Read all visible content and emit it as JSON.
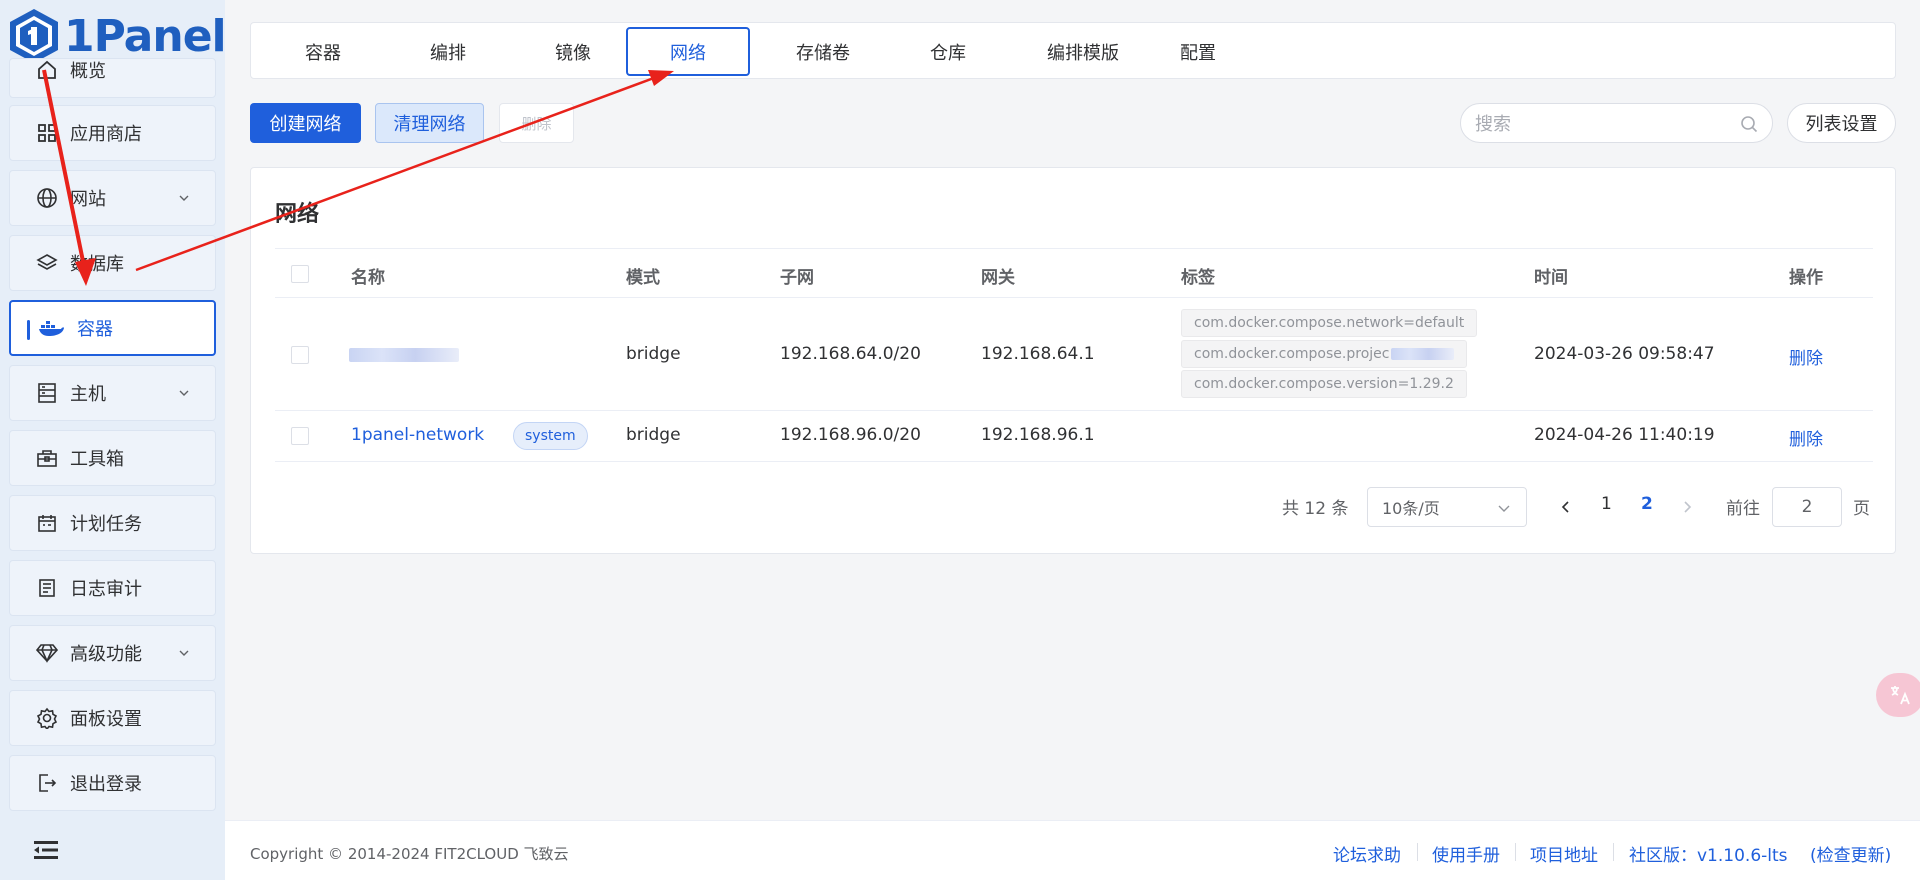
{
  "app": {
    "logo_text": "1Panel"
  },
  "sidebar": {
    "items": [
      {
        "label": "概览",
        "icon": "home-icon"
      },
      {
        "label": "应用商店",
        "icon": "apps-icon"
      },
      {
        "label": "网站",
        "icon": "globe-icon",
        "expandable": true
      },
      {
        "label": "数据库",
        "icon": "layers-icon"
      },
      {
        "label": "容器",
        "icon": "docker-icon",
        "active": true
      },
      {
        "label": "主机",
        "icon": "server-icon",
        "expandable": true
      },
      {
        "label": "工具箱",
        "icon": "toolbox-icon"
      },
      {
        "label": "计划任务",
        "icon": "calendar-icon"
      },
      {
        "label": "日志审计",
        "icon": "log-icon"
      },
      {
        "label": "高级功能",
        "icon": "diamond-icon",
        "expandable": true
      },
      {
        "label": "面板设置",
        "icon": "gear-icon"
      },
      {
        "label": "退出登录",
        "icon": "logout-icon"
      }
    ]
  },
  "tabs": [
    "容器",
    "编排",
    "镜像",
    "网络",
    "存储卷",
    "仓库",
    "编排模版",
    "配置"
  ],
  "active_tab": "网络",
  "toolbar": {
    "create_label": "创建网络",
    "prune_label": "清理网络",
    "delete_label": "删除",
    "search_placeholder": "搜索",
    "columns_label": "列表设置"
  },
  "card": {
    "title": "网络",
    "columns": [
      "名称",
      "模式",
      "子网",
      "网关",
      "标签",
      "时间",
      "操作"
    ],
    "rows": [
      {
        "name": "",
        "mode": "bridge",
        "subnet": "192.168.64.0/20",
        "gateway": "192.168.64.1",
        "tags": [
          "com.docker.compose.network=default",
          "com.docker.compose.projec",
          "com.docker.compose.version=1.29.2"
        ],
        "time": "2024-03-26 09:58:47",
        "action": "删除"
      },
      {
        "name": "1panel-network",
        "badge": "system",
        "mode": "bridge",
        "subnet": "192.168.96.0/20",
        "gateway": "192.168.96.1",
        "tags": [],
        "time": "2024-04-26 11:40:19",
        "action": "删除"
      }
    ]
  },
  "pagination": {
    "total_text": "共 12 条",
    "page_size": "10条/页",
    "pages": [
      "1",
      "2"
    ],
    "current_page": "2",
    "goto_label": "前往",
    "goto_value": "2",
    "page_suffix": "页"
  },
  "footer": {
    "copyright": "Copyright © 2014-2024 FIT2CLOUD 飞致云",
    "links": [
      "论坛求助",
      "使用手册",
      "项目地址",
      "社区版：v1.10.6-lts",
      "(检查更新)"
    ]
  },
  "colors": {
    "primary": "#1f5fdc",
    "annotation": "#e8221b",
    "sidebar_bg": "#e6eef8"
  }
}
